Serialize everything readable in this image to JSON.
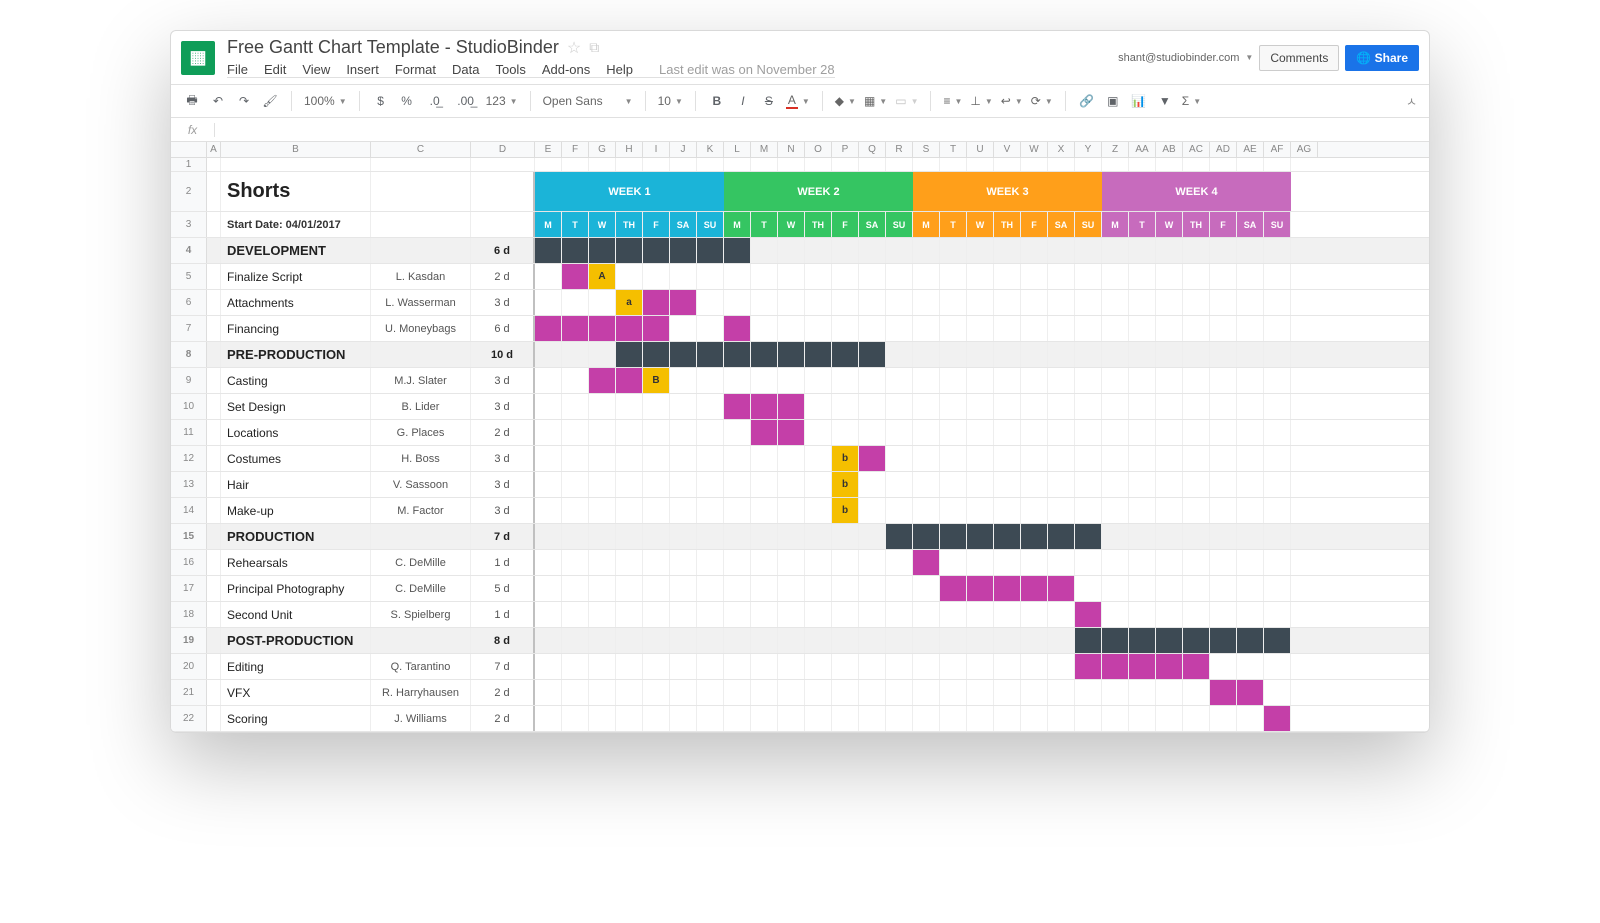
{
  "header": {
    "doc_title": "Free Gantt Chart Template - StudioBinder",
    "account_email": "shant@studiobinder.com",
    "comments_label": "Comments",
    "share_label": "Share",
    "last_edit": "Last edit was on November 28"
  },
  "menu": [
    "File",
    "Edit",
    "View",
    "Insert",
    "Format",
    "Data",
    "Tools",
    "Add-ons",
    "Help"
  ],
  "toolbar": {
    "zoom": "100%",
    "currency": "$",
    "percent": "%",
    "dec_dec": ".0",
    "dec_inc": ".00",
    "num_fmt": "123",
    "font": "Open Sans",
    "size": "10"
  },
  "fx_label": "fx",
  "columns": [
    "A",
    "B",
    "C",
    "D",
    "E",
    "F",
    "G",
    "H",
    "I",
    "J",
    "K",
    "L",
    "M",
    "N",
    "O",
    "P",
    "Q",
    "R",
    "S",
    "T",
    "U",
    "V",
    "W",
    "X",
    "Y",
    "Z",
    "AA",
    "AB",
    "AC",
    "AD",
    "AE",
    "AF",
    "AG"
  ],
  "weeks": [
    {
      "label": "WEEK 1",
      "cls": "w1",
      "days": [
        "M",
        "T",
        "W",
        "TH",
        "F",
        "SA",
        "SU"
      ]
    },
    {
      "label": "WEEK 2",
      "cls": "w2",
      "days": [
        "M",
        "T",
        "W",
        "TH",
        "F",
        "SA",
        "SU"
      ]
    },
    {
      "label": "WEEK 3",
      "cls": "w3",
      "days": [
        "M",
        "T",
        "W",
        "TH",
        "F",
        "SA",
        "SU"
      ]
    },
    {
      "label": "WEEK 4",
      "cls": "w4",
      "days": [
        "M",
        "T",
        "W",
        "TH",
        "F",
        "SA",
        "SU"
      ]
    }
  ],
  "sheet": {
    "title": "Shorts",
    "start_date_label": "Start Date: 04/01/2017"
  },
  "chart_data": {
    "type": "gantt",
    "title": "Shorts",
    "start_date": "04/01/2017",
    "day_count": 28,
    "weeks": [
      "WEEK 1",
      "WEEK 2",
      "WEEK 3",
      "WEEK 4"
    ],
    "day_labels": [
      "M",
      "T",
      "W",
      "TH",
      "F",
      "SA",
      "SU"
    ],
    "sections": [
      {
        "name": "DEVELOPMENT",
        "duration": "6 d",
        "bar": {
          "start": 0,
          "len": 8,
          "type": "section"
        },
        "tasks": [
          {
            "name": "Finalize Script",
            "owner": "L. Kasdan",
            "duration": "2 d",
            "bars": [
              {
                "start": 1,
                "len": 1,
                "type": "task"
              },
              {
                "start": 2,
                "len": 1,
                "type": "marker",
                "label": "A"
              }
            ]
          },
          {
            "name": "Attachments",
            "owner": "L. Wasserman",
            "duration": "3 d",
            "bars": [
              {
                "start": 3,
                "len": 1,
                "type": "marker",
                "label": "a"
              },
              {
                "start": 4,
                "len": 2,
                "type": "task"
              }
            ]
          },
          {
            "name": "Financing",
            "owner": "U. Moneybags",
            "duration": "6 d",
            "bars": [
              {
                "start": 0,
                "len": 5,
                "type": "task"
              },
              {
                "start": 7,
                "len": 1,
                "type": "task"
              }
            ]
          }
        ]
      },
      {
        "name": "PRE-PRODUCTION",
        "duration": "10 d",
        "bar": {
          "start": 3,
          "len": 10,
          "type": "section"
        },
        "tasks": [
          {
            "name": "Casting",
            "owner": "M.J. Slater",
            "duration": "3 d",
            "bars": [
              {
                "start": 2,
                "len": 2,
                "type": "task"
              },
              {
                "start": 4,
                "len": 1,
                "type": "marker",
                "label": "B"
              }
            ]
          },
          {
            "name": "Set Design",
            "owner": "B. Lider",
            "duration": "3 d",
            "bars": [
              {
                "start": 7,
                "len": 3,
                "type": "task"
              }
            ]
          },
          {
            "name": "Locations",
            "owner": "G. Places",
            "duration": "2 d",
            "bars": [
              {
                "start": 8,
                "len": 2,
                "type": "task"
              }
            ]
          },
          {
            "name": "Costumes",
            "owner": "H. Boss",
            "duration": "3 d",
            "bars": [
              {
                "start": 11,
                "len": 1,
                "type": "marker",
                "label": "b"
              },
              {
                "start": 12,
                "len": 1,
                "type": "task"
              }
            ]
          },
          {
            "name": "Hair",
            "owner": "V. Sassoon",
            "duration": "3 d",
            "bars": [
              {
                "start": 11,
                "len": 1,
                "type": "marker",
                "label": "b"
              }
            ]
          },
          {
            "name": "Make-up",
            "owner": "M. Factor",
            "duration": "3 d",
            "bars": [
              {
                "start": 11,
                "len": 1,
                "type": "marker",
                "label": "b"
              }
            ]
          }
        ]
      },
      {
        "name": "PRODUCTION",
        "duration": "7 d",
        "bar": {
          "start": 13,
          "len": 8,
          "type": "section"
        },
        "tasks": [
          {
            "name": "Rehearsals",
            "owner": "C. DeMille",
            "duration": "1 d",
            "bars": [
              {
                "start": 14,
                "len": 1,
                "type": "task"
              }
            ]
          },
          {
            "name": "Principal Photography",
            "owner": "C. DeMille",
            "duration": "5 d",
            "bars": [
              {
                "start": 15,
                "len": 5,
                "type": "task"
              }
            ]
          },
          {
            "name": "Second Unit",
            "owner": "S. Spielberg",
            "duration": "1 d",
            "bars": [
              {
                "start": 20,
                "len": 1,
                "type": "task"
              }
            ]
          }
        ]
      },
      {
        "name": "POST-PRODUCTION",
        "duration": "8 d",
        "bar": {
          "start": 20,
          "len": 8,
          "type": "section"
        },
        "tasks": [
          {
            "name": "Editing",
            "owner": "Q. Tarantino",
            "duration": "7 d",
            "bars": [
              {
                "start": 20,
                "len": 5,
                "type": "task"
              }
            ]
          },
          {
            "name": "VFX",
            "owner": "R. Harryhausen",
            "duration": "2 d",
            "bars": [
              {
                "start": 25,
                "len": 2,
                "type": "task"
              }
            ]
          },
          {
            "name": "Scoring",
            "owner": "J. Williams",
            "duration": "2 d",
            "bars": [
              {
                "start": 27,
                "len": 1,
                "type": "task"
              }
            ]
          }
        ]
      }
    ]
  }
}
